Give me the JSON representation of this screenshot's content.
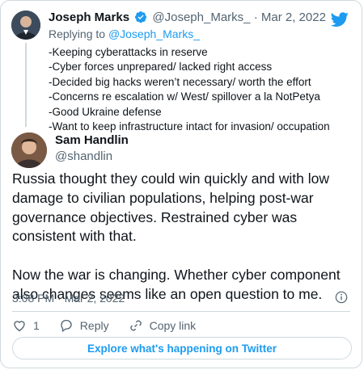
{
  "parent_tweet": {
    "name": "Joseph Marks",
    "handle": "@Joseph_Marks_",
    "dot": "·",
    "date": "Mar 2, 2022",
    "replying_prefix": "Replying to",
    "replying_handle": "@Joseph_Marks_",
    "lines": [
      "-Keeping cyberattacks in reserve",
      "-Cyber forces unprepared/ lacked right access",
      "-Decided big hacks weren’t necessary/ worth the effort",
      "-Concerns re escalation w/ West/ spillover a la NotPetya",
      "-Good Ukraine defense",
      "-Want to keep infrastructure intact for invasion/ occupation"
    ]
  },
  "main_tweet": {
    "name": "Sam Handlin",
    "handle": "@shandlin",
    "paragraphs": [
      "Russia thought they could win quickly and with low damage to civilian populations, helping post-war governance objectives.  Restrained cyber was consistent with that.",
      "Now the war is changing.  Whether cyber component also changes seems like an open question to me."
    ],
    "timestamp": "3:08 PM · Mar 2, 2022"
  },
  "actions": {
    "like_count": "1",
    "reply_label": "Reply",
    "copy_link_label": "Copy link"
  },
  "explore_label": "Explore what's happening on Twitter",
  "colors": {
    "twitter_blue": "#1d9bf0",
    "muted_text": "#536471",
    "border": "#cfd9de"
  },
  "icons": [
    "twitter-logo-icon",
    "verified-badge-icon",
    "info-icon",
    "heart-icon",
    "reply-icon",
    "link-icon"
  ]
}
